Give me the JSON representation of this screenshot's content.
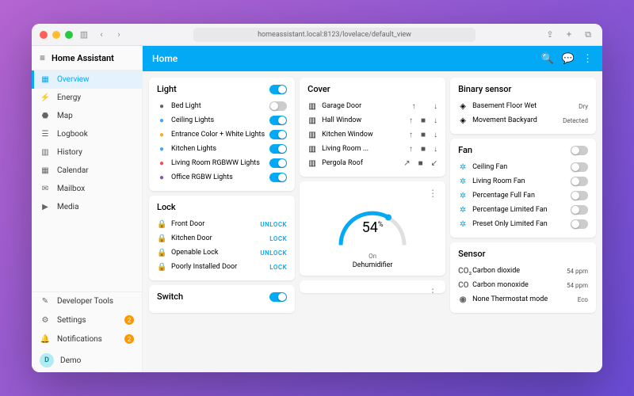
{
  "browser": {
    "url": "homeassistant.local:8123/lovelace/default_view"
  },
  "app_title": "Home Assistant",
  "topbar": {
    "title": "Home"
  },
  "sidebar": {
    "items": [
      {
        "label": "Overview",
        "active": true
      },
      {
        "label": "Energy"
      },
      {
        "label": "Map"
      },
      {
        "label": "Logbook"
      },
      {
        "label": "History"
      },
      {
        "label": "Calendar"
      },
      {
        "label": "Mailbox"
      },
      {
        "label": "Media"
      }
    ],
    "bottom": [
      {
        "label": "Developer Tools"
      },
      {
        "label": "Settings",
        "badge": "2"
      },
      {
        "label": "Notifications",
        "badge": "2"
      }
    ],
    "user": {
      "initial": "D",
      "label": "Demo"
    }
  },
  "cards": {
    "light": {
      "title": "Light",
      "master": true,
      "rows": [
        {
          "name": "Bed Light",
          "on": false,
          "cls": "blk"
        },
        {
          "name": "Ceiling Lights",
          "on": true,
          "cls": "blu"
        },
        {
          "name": "Entrance Color + White Lights",
          "on": true,
          "cls": ""
        },
        {
          "name": "Kitchen Lights",
          "on": true,
          "cls": "blu"
        },
        {
          "name": "Living Room RGBWW Lights",
          "on": true,
          "cls": "red"
        },
        {
          "name": "Office RGBW Lights",
          "on": true,
          "cls": "pur"
        }
      ]
    },
    "lock": {
      "title": "Lock",
      "rows": [
        {
          "name": "Front Door",
          "action": "UNLOCK"
        },
        {
          "name": "Kitchen Door",
          "action": "LOCK"
        },
        {
          "name": "Openable Lock",
          "action": "UNLOCK"
        },
        {
          "name": "Poorly Installed Door",
          "action": "LOCK"
        }
      ]
    },
    "switch": {
      "title": "Switch",
      "master": true
    },
    "cover": {
      "title": "Cover",
      "rows": [
        {
          "name": "Garage Door",
          "btns": [
            "↑",
            "",
            "↓"
          ]
        },
        {
          "name": "Hall Window",
          "btns": [
            "↑",
            "■",
            "↓"
          ]
        },
        {
          "name": "Kitchen Window",
          "btns": [
            "↑",
            "■",
            "↓"
          ]
        },
        {
          "name": "Living Room ...",
          "btns": [
            "↑",
            "■",
            "↓"
          ]
        },
        {
          "name": "Pergola Roof",
          "btns": [
            "↗",
            "■",
            "↙"
          ]
        }
      ]
    },
    "gauge": {
      "value": "54",
      "unit": "%",
      "state": "On",
      "name": "Dehumidifier"
    },
    "binary": {
      "title": "Binary sensor",
      "rows": [
        {
          "name": "Basement Floor Wet",
          "val": "Dry"
        },
        {
          "name": "Movement Backyard",
          "val": "Detected"
        }
      ]
    },
    "fan": {
      "title": "Fan",
      "master": false,
      "rows": [
        {
          "name": "Ceiling Fan",
          "on": false
        },
        {
          "name": "Living Room Fan",
          "on": false
        },
        {
          "name": "Percentage Full Fan",
          "on": false
        },
        {
          "name": "Percentage Limited Fan",
          "on": false
        },
        {
          "name": "Preset Only Limited Fan",
          "on": false
        }
      ]
    },
    "sensor": {
      "title": "Sensor",
      "rows": [
        {
          "name": "Carbon dioxide",
          "val": "54 ppm",
          "ic": "CO₂"
        },
        {
          "name": "Carbon monoxide",
          "val": "54 ppm",
          "ic": "CO"
        },
        {
          "name": "None Thermostat mode",
          "val": "Eco",
          "ic": "◉"
        }
      ]
    }
  }
}
